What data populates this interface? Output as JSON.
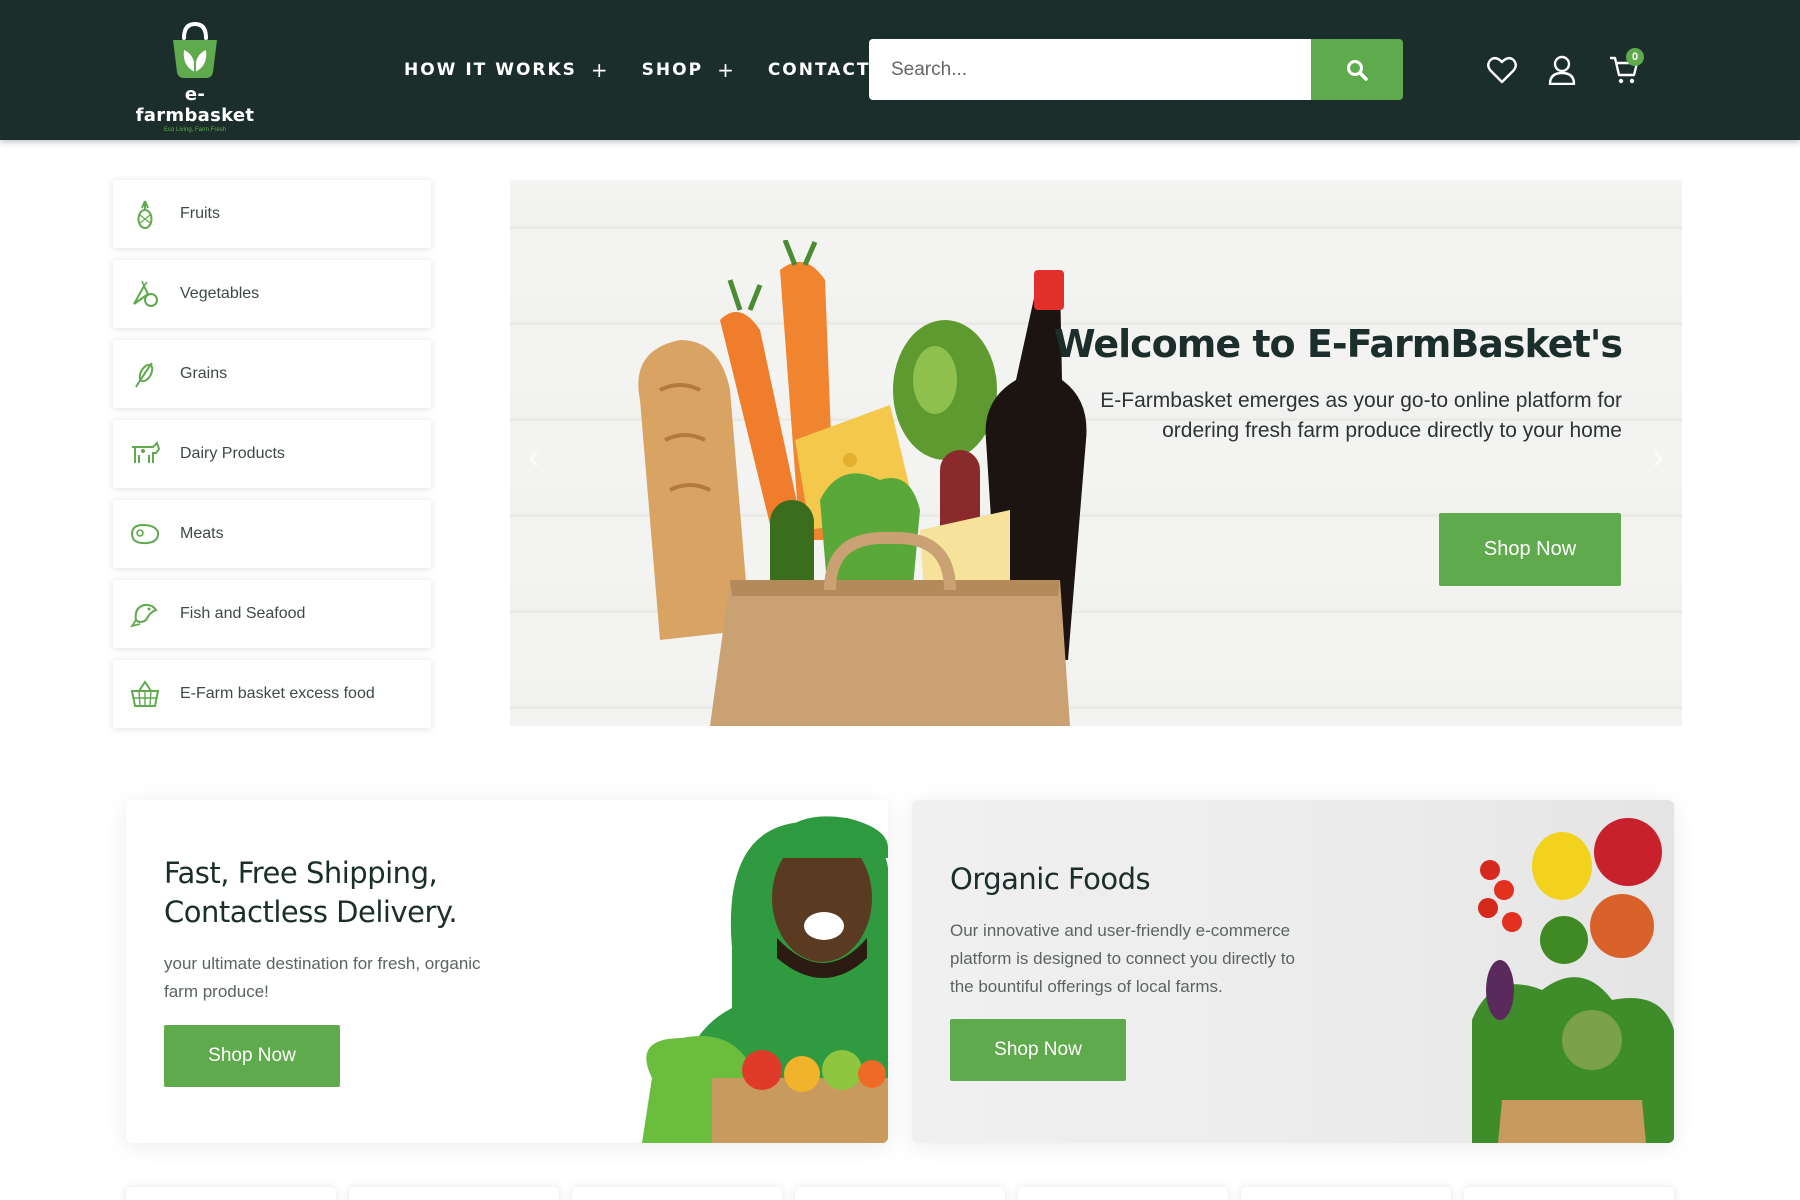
{
  "brand": {
    "name": "e-farmbasket",
    "tagline": "Eco Living, Farm Fresh",
    "accent": "#5faa4c",
    "header_bg": "#1b2e2b"
  },
  "nav": {
    "items": [
      {
        "label": "HOW IT WORKS",
        "has_submenu": true
      },
      {
        "label": "SHOP",
        "has_submenu": true
      },
      {
        "label": "CONTACT",
        "has_submenu": false
      }
    ],
    "plus": "+"
  },
  "search": {
    "placeholder": "Search...",
    "value": "",
    "button_icon": "search-icon"
  },
  "header_icons": {
    "wishlist": "heart-icon",
    "account": "user-icon",
    "cart": "cart-icon",
    "cart_count": "0"
  },
  "categories": [
    {
      "label": "Fruits",
      "icon": "pineapple-icon"
    },
    {
      "label": "Vegetables",
      "icon": "vegetables-icon"
    },
    {
      "label": "Grains",
      "icon": "grain-icon"
    },
    {
      "label": "Dairy Products",
      "icon": "cow-icon"
    },
    {
      "label": "Meats",
      "icon": "meat-icon"
    },
    {
      "label": "Fish and Seafood",
      "icon": "fish-icon"
    },
    {
      "label": "E-Farm basket excess food",
      "icon": "basket-icon"
    }
  ],
  "hero": {
    "title": "Welcome to E-FarmBasket's",
    "text": "E-Farmbasket emerges as your go-to online platform for ordering fresh farm produce directly to your home",
    "button": "Shop Now",
    "prev": "‹",
    "next": "›"
  },
  "promos": [
    {
      "title_line1": "Fast, Free Shipping,",
      "title_line2": "Contactless Delivery.",
      "text_line1": "your ultimate destination for fresh, organic",
      "text_line2": "farm produce!",
      "button": "Shop Now"
    },
    {
      "title": "Organic Foods",
      "text_line1": "Our innovative and user-friendly e-commerce",
      "text_line2": "platform is designed to connect you directly to",
      "text_line3": "the bountiful offerings of local farms.",
      "button": "Shop Now"
    }
  ]
}
